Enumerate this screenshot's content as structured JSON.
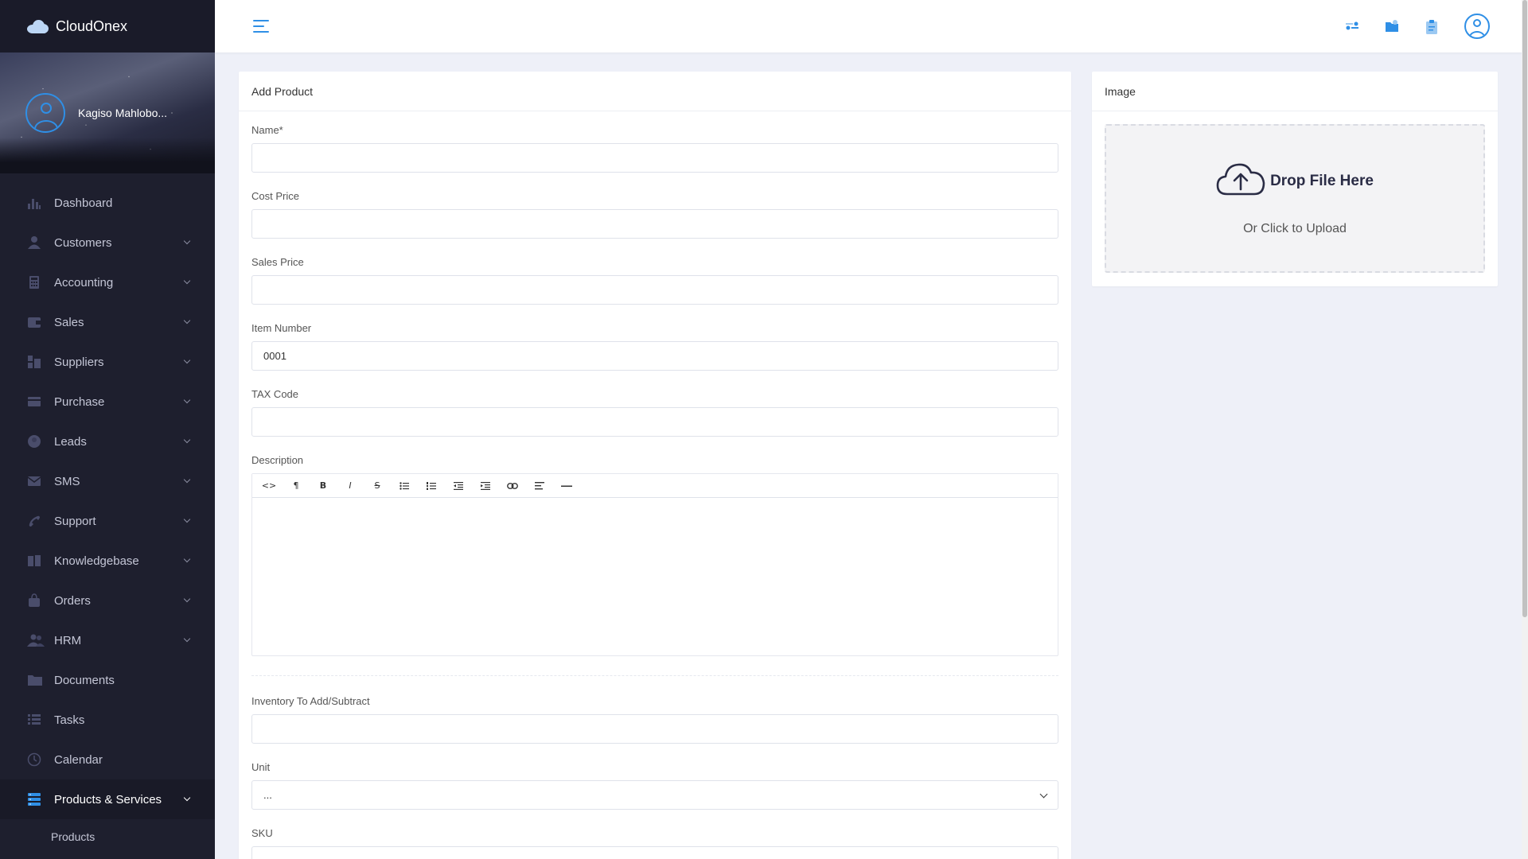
{
  "app": {
    "name": "CloudOnex"
  },
  "user": {
    "name": "Kagiso Mahlobo..."
  },
  "colors": {
    "accent": "#2f8fe6",
    "sidebar_bg": "#1e1f2e",
    "page_bg": "#eef0f8"
  },
  "sidebar": {
    "items": [
      {
        "label": "Dashboard",
        "icon": "bar-chart-icon"
      },
      {
        "label": "Customers",
        "icon": "user-icon"
      },
      {
        "label": "Accounting",
        "icon": "calculator-icon"
      },
      {
        "label": "Sales",
        "icon": "wallet-icon"
      },
      {
        "label": "Suppliers",
        "icon": "building-icon"
      },
      {
        "label": "Purchase",
        "icon": "credit-card-icon"
      },
      {
        "label": "Leads",
        "icon": "user-circle-icon"
      },
      {
        "label": "SMS",
        "icon": "envelope-icon"
      },
      {
        "label": "Support",
        "icon": "phone-icon"
      },
      {
        "label": "Knowledgebase",
        "icon": "book-icon"
      },
      {
        "label": "Orders",
        "icon": "shopping-bag-icon"
      },
      {
        "label": "HRM",
        "icon": "users-icon"
      },
      {
        "label": "Documents",
        "icon": "folder-icon"
      },
      {
        "label": "Tasks",
        "icon": "list-icon"
      },
      {
        "label": "Calendar",
        "icon": "clock-icon"
      },
      {
        "label": "Products & Services",
        "icon": "server-icon"
      }
    ],
    "sub_items": [
      {
        "label": "Products"
      }
    ]
  },
  "main": {
    "title": "Add Product",
    "fields": {
      "name": {
        "label": "Name*",
        "value": ""
      },
      "cost_price": {
        "label": "Cost Price",
        "value": ""
      },
      "sales_price": {
        "label": "Sales Price",
        "value": ""
      },
      "item_number": {
        "label": "Item Number",
        "value": "0001"
      },
      "tax_code": {
        "label": "TAX Code",
        "value": ""
      },
      "description": {
        "label": "Description"
      },
      "inventory": {
        "label": "Inventory To Add/Subtract",
        "value": ""
      },
      "unit": {
        "label": "Unit",
        "value": "..."
      },
      "sku": {
        "label": "SKU"
      }
    },
    "editor_toolbar": [
      "<>",
      "¶",
      "B",
      "I",
      "S",
      "ul",
      "ol",
      "outdent",
      "indent",
      "link",
      "align",
      "hr"
    ]
  },
  "image_card": {
    "title": "Image",
    "drop_title": "Drop File Here",
    "drop_sub": "Or Click to Upload"
  }
}
